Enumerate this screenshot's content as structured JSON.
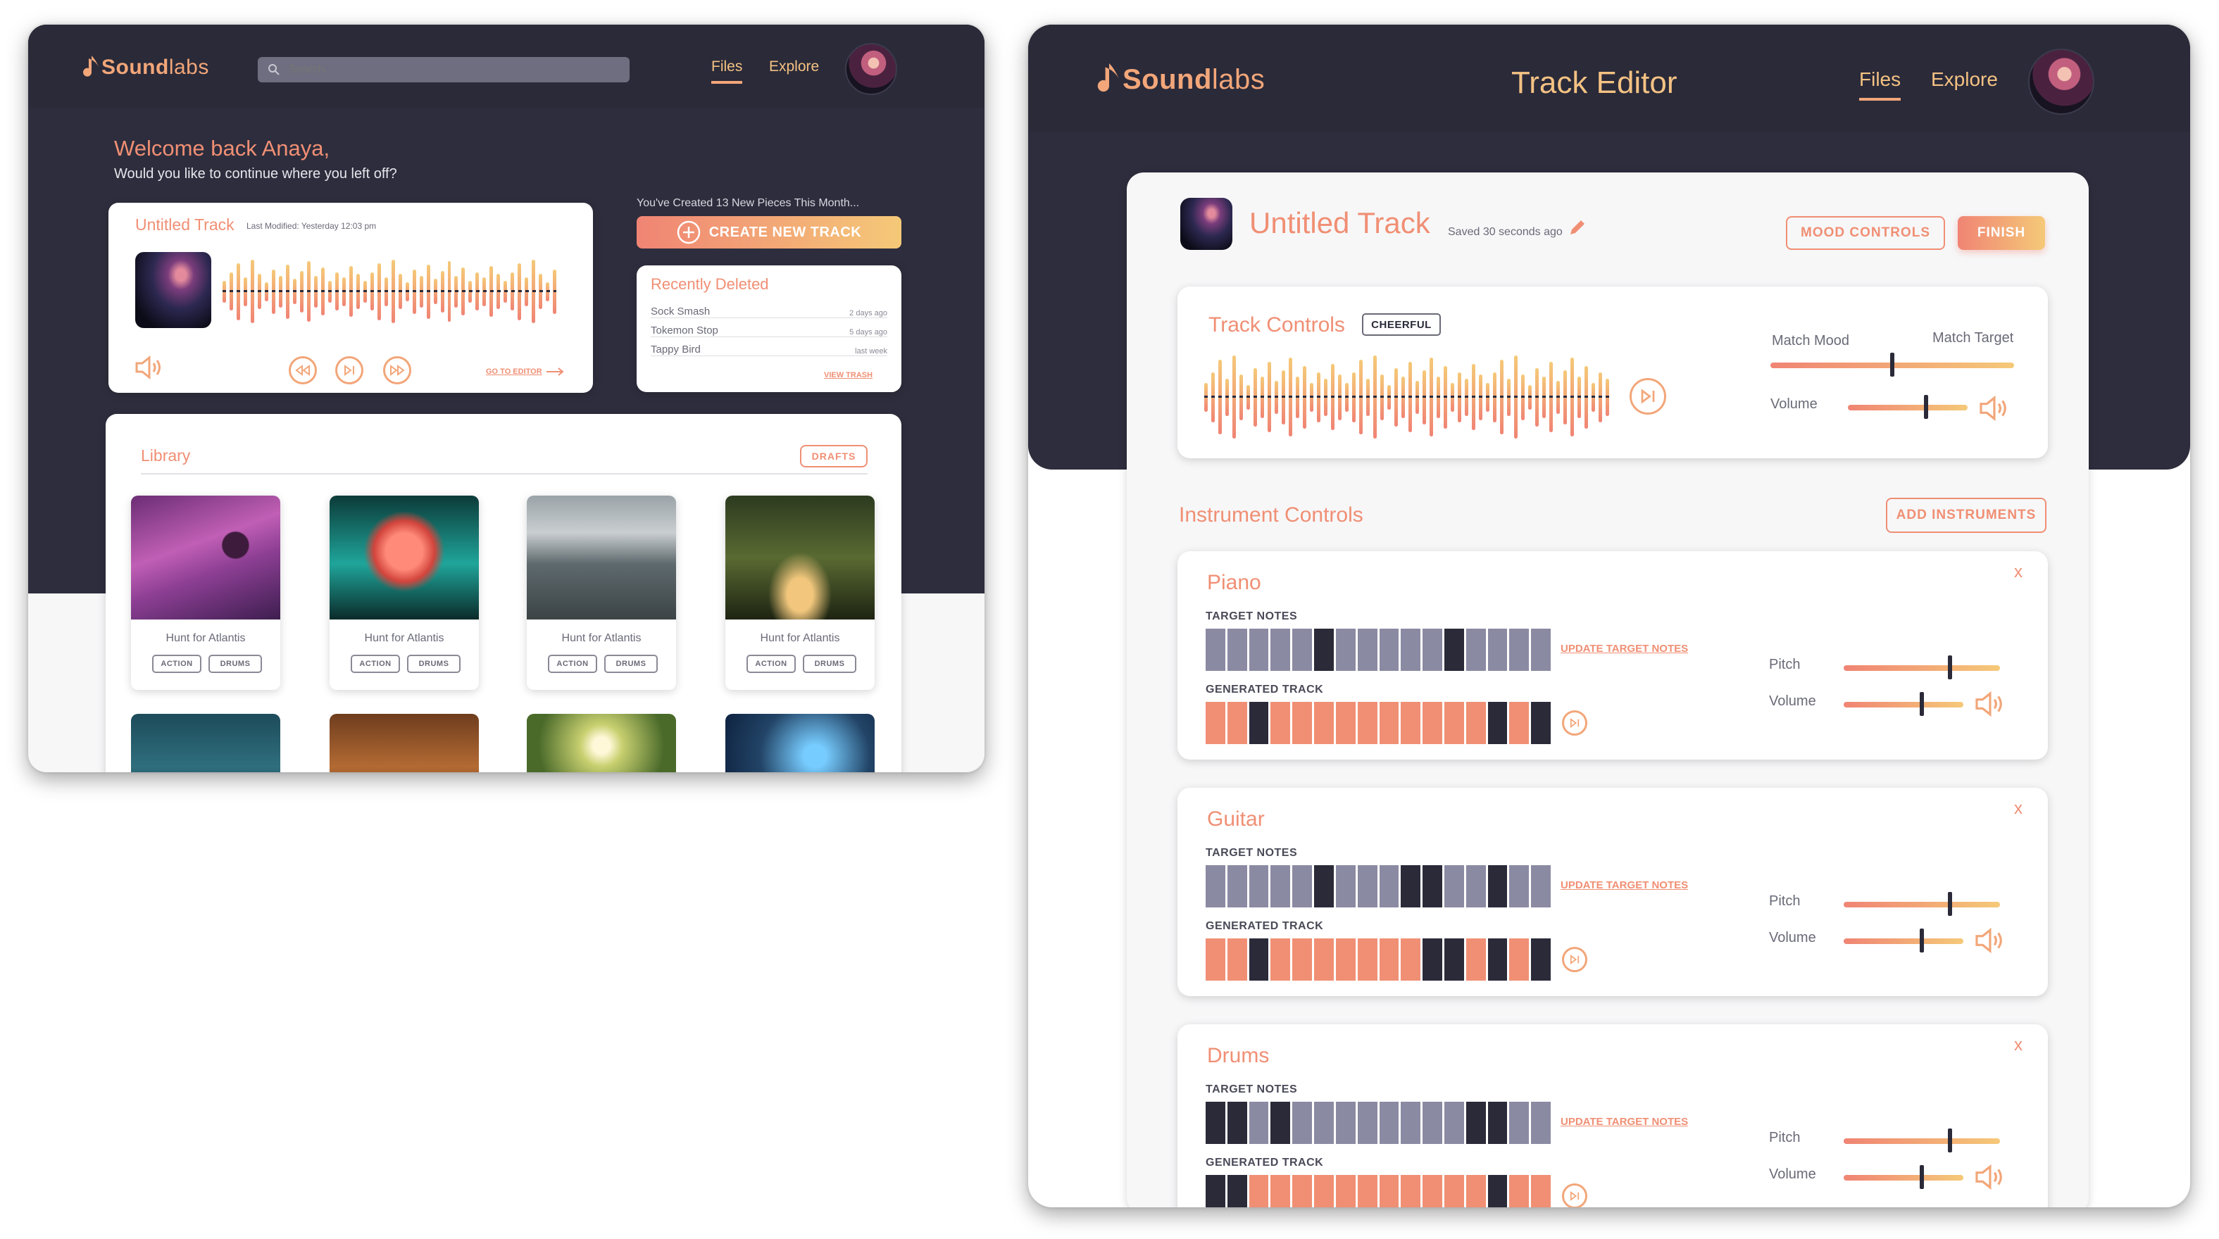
{
  "left": {
    "logo_text_bold": "Sound",
    "logo_text_light": "labs",
    "search_placeholder": "Search...",
    "nav": [
      "Files",
      "Explore"
    ],
    "welcome_title": "Welcome back Anaya,",
    "welcome_sub": "Would you like to continue where you left off?",
    "track_title": "Untitled Track",
    "track_modified": "Last Modified: Yesterday 12:03 pm",
    "go_to_editor": "GO TO EDITOR",
    "created_count": "You've Created 13 New  Pieces This Month...",
    "create_button": "CREATE NEW TRACK",
    "recently_deleted_title": "Recently Deleted",
    "recently_deleted": [
      {
        "name": "Sock Smash",
        "time": "2 days ago"
      },
      {
        "name": "Tokemon Stop",
        "time": "5 days ago"
      },
      {
        "name": "Tappy Bird",
        "time": "last week"
      }
    ],
    "view_trash": "VIEW TRASH",
    "library_title": "Library",
    "drafts_label": "DRAFTS",
    "library_items": [
      {
        "title": "Hunt for Atlantis",
        "tags": [
          "ACTION",
          "DRUMS"
        ]
      },
      {
        "title": "Hunt for Atlantis",
        "tags": [
          "ACTION",
          "DRUMS"
        ]
      },
      {
        "title": "Hunt for Atlantis",
        "tags": [
          "ACTION",
          "DRUMS"
        ]
      },
      {
        "title": "Hunt for Atlantis",
        "tags": [
          "ACTION",
          "DRUMS"
        ]
      }
    ]
  },
  "right": {
    "logo_text_bold": "Sound",
    "logo_text_light": "labs",
    "page_title": "Track Editor",
    "nav": [
      "Files",
      "Explore"
    ],
    "track_title": "Untitled Track",
    "saved_status": "Saved 30 seconds ago",
    "mood_controls": "MOOD CONTROLS",
    "finish": "FINISH",
    "track_controls_title": "Track Controls",
    "mood_tag": "CHEERFUL",
    "match_mood": "Match Mood",
    "match_target": "Match Target",
    "match_value": 0.5,
    "volume_label": "Volume",
    "volume_value": 0.65,
    "instrument_controls_title": "Instrument Controls",
    "add_instruments": "ADD INSTRUMENTS",
    "target_notes_label": "TARGET NOTES",
    "generated_track_label": "GENERATED TRACK",
    "update_target_notes": "UPDATE TARGET NOTES",
    "pitch_label": "Pitch",
    "close_symbol": "x",
    "instruments": [
      {
        "name": "Piano",
        "pitch": 0.68,
        "volume": 0.65,
        "target": [
          0,
          0,
          0,
          0,
          0,
          1,
          0,
          0,
          0,
          0,
          0,
          1,
          0,
          0,
          0,
          0
        ],
        "generated": [
          0,
          0,
          1,
          0,
          0,
          0,
          0,
          0,
          0,
          0,
          0,
          0,
          0,
          1,
          0,
          1
        ]
      },
      {
        "name": "Guitar",
        "pitch": 0.68,
        "volume": 0.65,
        "target": [
          0,
          0,
          0,
          0,
          0,
          1,
          0,
          0,
          0,
          1,
          1,
          0,
          0,
          1,
          0,
          0
        ],
        "generated": [
          0,
          0,
          1,
          0,
          0,
          0,
          0,
          0,
          0,
          0,
          1,
          1,
          0,
          1,
          0,
          1
        ]
      },
      {
        "name": "Drums",
        "pitch": 0.68,
        "volume": 0.65,
        "target": [
          1,
          1,
          0,
          1,
          0,
          0,
          0,
          0,
          0,
          0,
          0,
          0,
          1,
          1,
          0,
          0
        ],
        "generated": [
          1,
          1,
          0,
          0,
          0,
          0,
          0,
          0,
          0,
          0,
          0,
          0,
          0,
          1,
          0,
          0
        ]
      }
    ]
  },
  "colors": {
    "dark": "#2a2a39",
    "salmon": "#f08f74",
    "gold": "#f5c978",
    "note_off": "#8a8aa3",
    "note_on": "#2a2a39",
    "gen_off": "#f08f74"
  }
}
